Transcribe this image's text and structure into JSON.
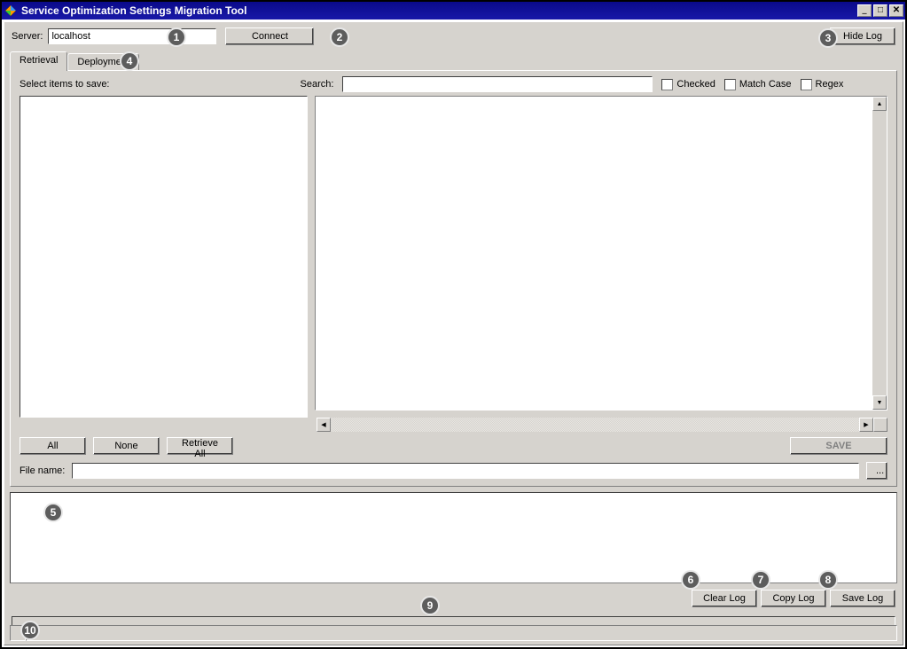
{
  "title": "Service Optimization Settings Migration Tool",
  "server": {
    "label": "Server:",
    "value": "localhost",
    "connect": "Connect",
    "hideLog": "Hide Log"
  },
  "tabs": {
    "retrieval": "Retrieval",
    "deployment": "Deployment"
  },
  "retrieval": {
    "instruction": "Select items to save:",
    "searchLabel": "Search:",
    "searchValue": "",
    "checked": "Checked",
    "matchCase": "Match Case",
    "regex": "Regex",
    "all": "All",
    "none": "None",
    "retrieveAll": "Retrieve All",
    "save": "SAVE",
    "fileNameLabel": "File name:",
    "fileNameValue": "",
    "browse": "..."
  },
  "log": {
    "clear": "Clear Log",
    "copy": "Copy Log",
    "save": "Save Log"
  },
  "annotations": [
    "1",
    "2",
    "3",
    "4",
    "5",
    "6",
    "7",
    "8",
    "9",
    "10"
  ]
}
